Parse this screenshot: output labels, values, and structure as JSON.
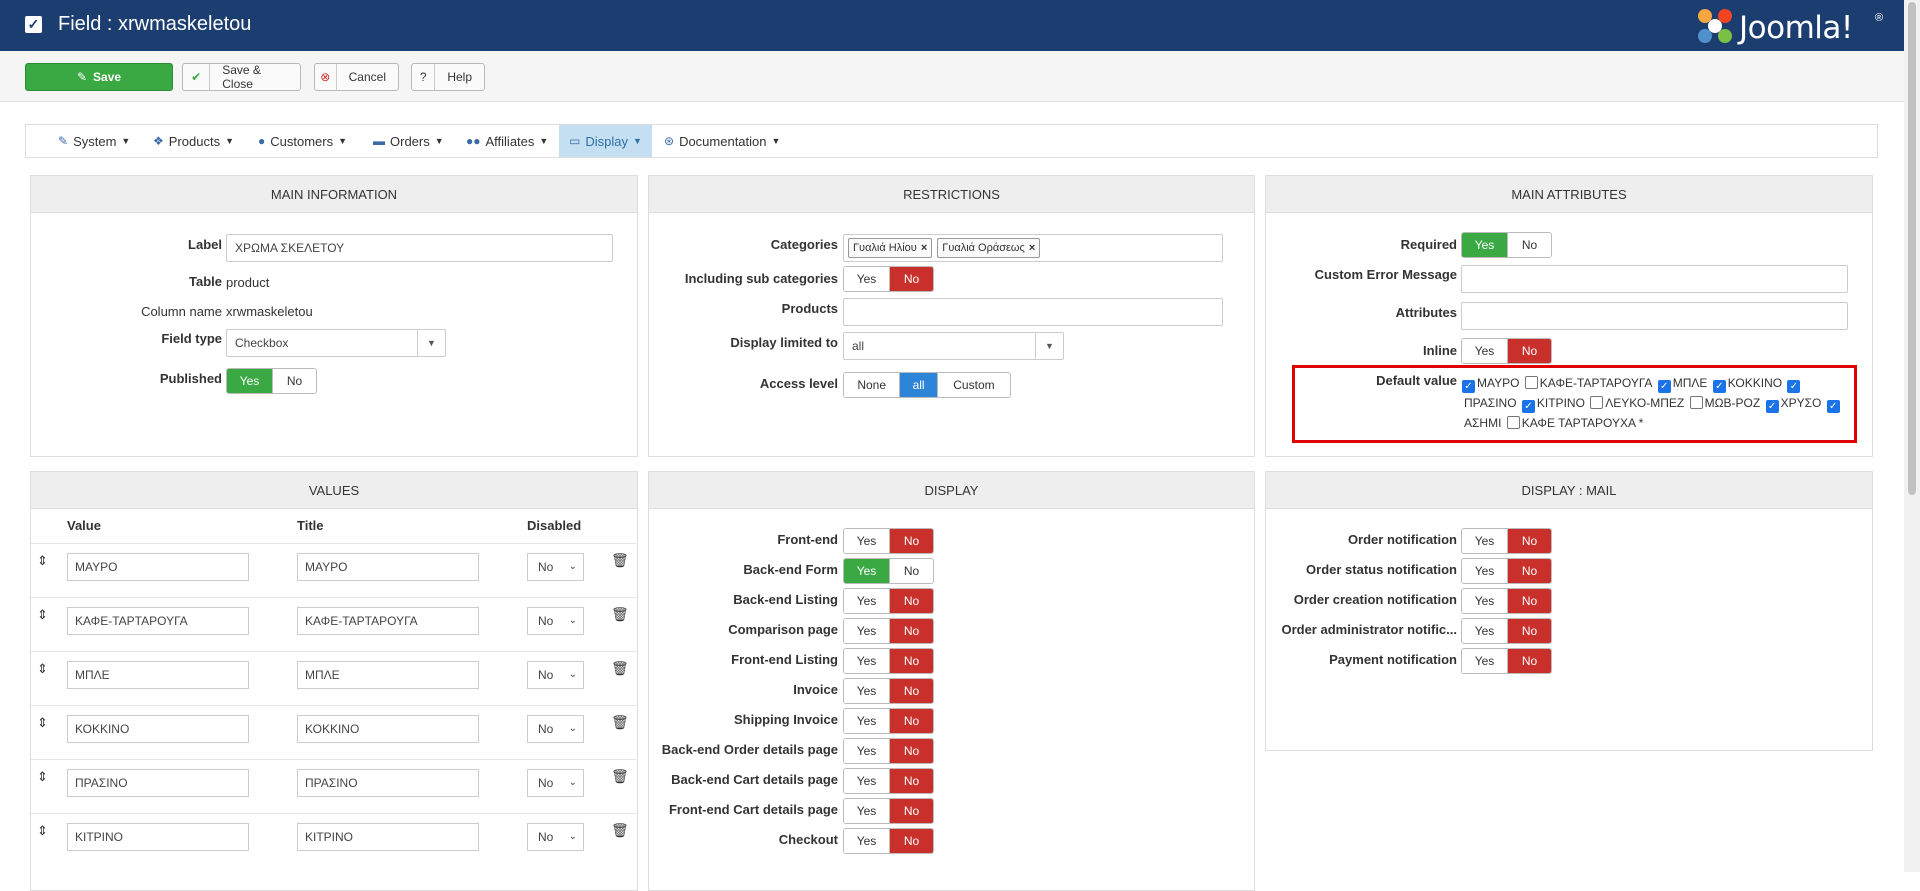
{
  "header": {
    "title": "Field : xrwmaskeletou",
    "logo_text": "Joomla!",
    "logo_reg": "®"
  },
  "toolbar": {
    "save": "Save",
    "save_close": "Save & Close",
    "cancel": "Cancel",
    "help": "Help",
    "save_icon": "pencil-square-icon",
    "check_icon": "check-icon",
    "cancel_icon": "x-circle-icon",
    "help_icon": "question-icon"
  },
  "menu": [
    {
      "label": "System",
      "icon": "wrench-icon"
    },
    {
      "label": "Products",
      "icon": "cubes-icon"
    },
    {
      "label": "Customers",
      "icon": "user-icon"
    },
    {
      "label": "Orders",
      "icon": "credit-card-icon"
    },
    {
      "label": "Affiliates",
      "icon": "users-icon"
    },
    {
      "label": "Display",
      "icon": "monitor-icon",
      "active": true
    },
    {
      "label": "Documentation",
      "icon": "life-ring-icon"
    }
  ],
  "main_info": {
    "title": "MAIN INFORMATION",
    "label_lbl": "Label",
    "label_val": "ΧΡΩΜΑ ΣΚΕΛΕΤΟΥ",
    "table_lbl": "Table",
    "table_val": "product",
    "column_lbl": "Column name",
    "column_val": "xrwmaskeletou",
    "type_lbl": "Field type",
    "type_val": "Checkbox",
    "published_lbl": "Published",
    "yes": "Yes",
    "no": "No"
  },
  "restrictions": {
    "title": "RESTRICTIONS",
    "categories_lbl": "Categories",
    "categories": [
      "Γυαλιά Ηλίου",
      "Γυαλιά Οράσεως"
    ],
    "sub_lbl": "Including sub categories",
    "products_lbl": "Products",
    "display_lbl": "Display limited to",
    "display_val": "all",
    "access_lbl": "Access level",
    "access_options": [
      "None",
      "all",
      "Custom"
    ],
    "yes": "Yes",
    "no": "No"
  },
  "attributes": {
    "title": "MAIN ATTRIBUTES",
    "required_lbl": "Required",
    "error_lbl": "Custom Error Message",
    "attrs_lbl": "Attributes",
    "inline_lbl": "Inline",
    "default_lbl": "Default value",
    "default_values": [
      {
        "label": "ΜΑΥΡΟ",
        "checked": true
      },
      {
        "label": "ΚΑΦΕ-ΤΑΡΤΑΡΟΥΓΑ",
        "checked": false
      },
      {
        "label": "ΜΠΛΕ",
        "checked": true
      },
      {
        "label": "ΚΟΚΚΙΝΟ",
        "checked": true
      },
      {
        "label": "ΠΡΑΣΙΝΟ",
        "checked": true
      },
      {
        "label": "ΚΙΤΡΙΝΟ",
        "checked": true
      },
      {
        "label": "ΛΕΥΚΟ-ΜΠΕΖ",
        "checked": false
      },
      {
        "label": "ΜΩΒ-ΡΟΖ",
        "checked": false
      },
      {
        "label": "ΧΡΥΣΟ",
        "checked": true
      },
      {
        "label": "ΑΣΗΜΙ",
        "checked": true
      },
      {
        "label": "ΚΑΦΕ ΤΑΡΤΑΡΟΥΧΑ *",
        "checked": false
      }
    ],
    "yes": "Yes",
    "no": "No"
  },
  "values": {
    "title": "VALUES",
    "col_value": "Value",
    "col_title": "Title",
    "col_disabled": "Disabled",
    "rows": [
      {
        "value": "ΜΑΥΡΟ",
        "title": "ΜΑΥΡΟ",
        "disabled": "No"
      },
      {
        "value": "ΚΑΦΕ-ΤΑΡΤΑΡΟΥΓΑ",
        "title": "ΚΑΦΕ-ΤΑΡΤΑΡΟΥΓΑ",
        "disabled": "No"
      },
      {
        "value": "ΜΠΛΕ",
        "title": "ΜΠΛΕ",
        "disabled": "No"
      },
      {
        "value": "ΚΟΚΚΙΝΟ",
        "title": "ΚΟΚΚΙΝΟ",
        "disabled": "No"
      },
      {
        "value": "ΠΡΑΣΙΝΟ",
        "title": "ΠΡΑΣΙΝΟ",
        "disabled": "No"
      },
      {
        "value": "ΚΙΤΡΙΝΟ",
        "title": "ΚΙΤΡΙΝΟ",
        "disabled": "No"
      }
    ]
  },
  "display": {
    "title": "DISPLAY",
    "rows": [
      {
        "label": "Front-end",
        "value": "No"
      },
      {
        "label": "Back-end Form",
        "value": "Yes"
      },
      {
        "label": "Back-end Listing",
        "value": "No"
      },
      {
        "label": "Comparison page",
        "value": "No"
      },
      {
        "label": "Front-end Listing",
        "value": "No"
      },
      {
        "label": "Invoice",
        "value": "No"
      },
      {
        "label": "Shipping Invoice",
        "value": "No"
      },
      {
        "label": "Back-end Order details page",
        "value": "No"
      },
      {
        "label": "Back-end Cart details page",
        "value": "No"
      },
      {
        "label": "Front-end Cart details page",
        "value": "No"
      },
      {
        "label": "Checkout",
        "value": "No"
      }
    ],
    "yes": "Yes",
    "no": "No"
  },
  "mail": {
    "title": "DISPLAY : MAIL",
    "rows": [
      {
        "label": "Order notification",
        "value": "No"
      },
      {
        "label": "Order status notification",
        "value": "No"
      },
      {
        "label": "Order creation notification",
        "value": "No"
      },
      {
        "label": "Order administrator notific...",
        "value": "No"
      },
      {
        "label": "Payment notification",
        "value": "No"
      }
    ],
    "yes": "Yes",
    "no": "No"
  },
  "colors": {
    "header": "#1c3d6f",
    "green": "#3aa944",
    "red": "#c9302c",
    "blue": "#2d85d8",
    "highlight": "#e00000"
  }
}
